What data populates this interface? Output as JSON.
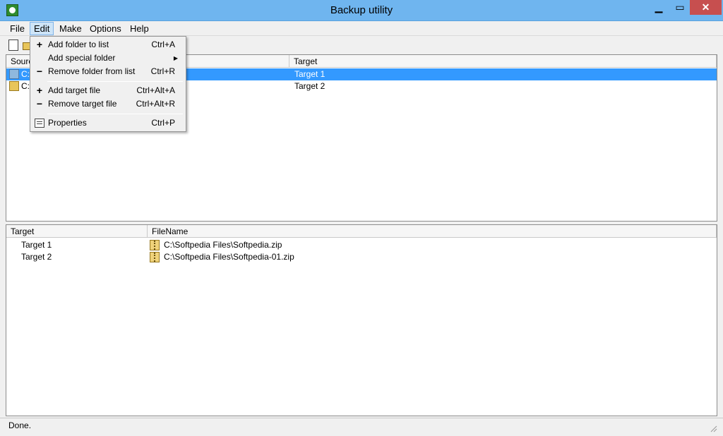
{
  "window": {
    "title": "Backup utility",
    "minimize": "▁",
    "maximize": "▭",
    "close": "✕"
  },
  "menubar": {
    "items": [
      "File",
      "Edit",
      "Make",
      "Options",
      "Help"
    ]
  },
  "toolbar": {
    "icons": [
      "new-document-icon",
      "open-folder-icon"
    ]
  },
  "top_list": {
    "columns": [
      "Source",
      "Target"
    ],
    "rows": [
      {
        "source": "C:\\",
        "target": "Target 1",
        "icon": "blue-folder-icon"
      },
      {
        "source": "C:\\",
        "target": "Target 2",
        "icon": "folder-icon"
      }
    ]
  },
  "bottom_list": {
    "columns": [
      "Target",
      "FileName"
    ],
    "rows": [
      {
        "target": "Target 1",
        "filename": "C:\\Softpedia Files\\Softpedia.zip"
      },
      {
        "target": "Target 2",
        "filename": "C:\\Softpedia Files\\Softpedia-01.zip"
      }
    ]
  },
  "edit_menu": {
    "items": [
      {
        "label": "Add folder to list",
        "shortcut": "Ctrl+A",
        "glyph": "+"
      },
      {
        "label": "Add special folder",
        "shortcut": "",
        "submenu_arrow": "▶"
      },
      {
        "label": "Remove folder from list",
        "shortcut": "Ctrl+R",
        "glyph": "−"
      },
      {
        "label": "Add target file",
        "shortcut": "Ctrl+Alt+A",
        "glyph": "+"
      },
      {
        "label": "Remove target file",
        "shortcut": "Ctrl+Alt+R",
        "glyph": "−"
      },
      {
        "label": "Properties",
        "shortcut": "Ctrl+P"
      }
    ]
  },
  "status": {
    "text": "Done."
  },
  "colors": {
    "titlebar": "#6fb5ef",
    "selection": "#3399ff",
    "close_button": "#c74f4f"
  }
}
